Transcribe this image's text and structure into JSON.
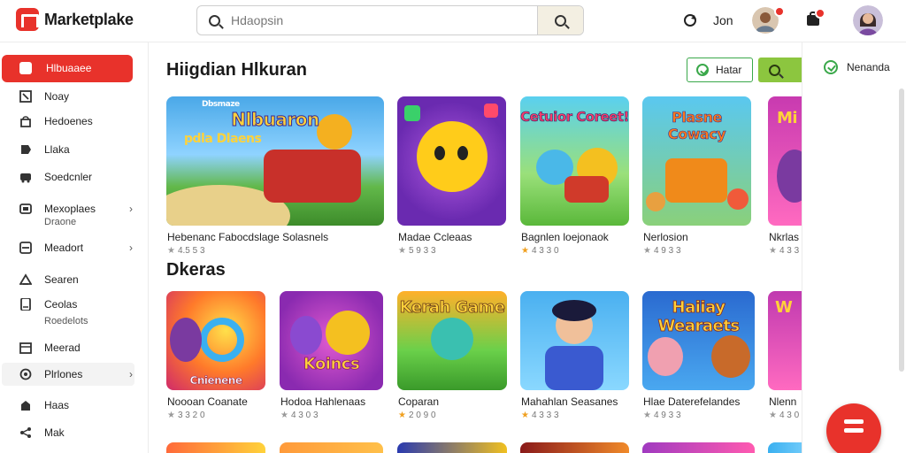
{
  "header": {
    "brand": "Marketplake",
    "search_placeholder": "Hdaopsin",
    "user_name": "Jon"
  },
  "sidebar": {
    "items": [
      {
        "label": "Hlbuaaee",
        "icon": "store-icon",
        "active": true
      },
      {
        "label": "Noay",
        "icon": "bookmark-icon"
      },
      {
        "label": "Hedoenes",
        "icon": "bag-icon"
      },
      {
        "label": "Llaka",
        "icon": "tag-icon"
      },
      {
        "label": "Soedcnler",
        "icon": "bus-icon"
      },
      {
        "label": "Mexoplaes",
        "icon": "book-icon",
        "sub": "Draone",
        "chevron": true
      },
      {
        "label": "Meadort",
        "icon": "grid-icon",
        "chevron": true
      },
      {
        "label": "Searen",
        "icon": "clock-icon"
      },
      {
        "label": "Ceolas",
        "icon": "phone-icon",
        "sub": "Roedelots"
      },
      {
        "label": "Meerad",
        "icon": "calendar-icon"
      },
      {
        "label": "Plrlones",
        "icon": "compass-icon",
        "chevron": true
      },
      {
        "label": "Haas",
        "icon": "home-icon"
      },
      {
        "label": "Mak",
        "icon": "share-icon"
      }
    ]
  },
  "main": {
    "section1_title": "Hiigdian Hlkuran",
    "section2_title": "Dkeras",
    "tag_button_1": "Hatar",
    "row1": [
      {
        "art_text": "Nlbuaron",
        "art_sub": "pdla Dlaens",
        "art_tag": "Dbsmaze",
        "title": "Hebenanc Fabocdslage Solasnels",
        "rating": "4.5 5 3",
        "gold": false
      },
      {
        "art_text": "",
        "title": "Madae Ccleaas",
        "rating": "5 9 3 3",
        "gold": false
      },
      {
        "art_text": "Cetuior Coreet!",
        "title": "Bagnlen loejonaok",
        "rating": "4 3 3 0",
        "gold": true
      },
      {
        "art_text": "Plasne Cowacy",
        "title": "Nerlosion",
        "rating": "4 9 3 3",
        "gold": false
      },
      {
        "art_text": "Mi",
        "title": "Nkrlas",
        "rating": "4 3 3",
        "gold": false
      }
    ],
    "row2": [
      {
        "art_text": "Cnienene",
        "title": "Noooan Coanate",
        "rating": "3 3 2 0",
        "gold": false
      },
      {
        "art_text": "Koincs",
        "title": "Hodoa Hahlenaas",
        "rating": "4 3 0 3",
        "gold": false
      },
      {
        "art_text": "Kerah Game",
        "title": "Coparan",
        "rating": "2 0 9 0",
        "gold": true
      },
      {
        "art_text": "",
        "title": "Mahahlan Seasanes",
        "rating": "4 3 3 3",
        "gold": true
      },
      {
        "art_text": "Haiiay Wearaets",
        "title": "Hlae Daterefelandes",
        "rating": "4 9 3 3",
        "gold": false
      },
      {
        "art_text": "W",
        "title": "Nlenn",
        "rating": "4 3 0",
        "gold": false
      }
    ]
  },
  "right_panel": {
    "item_label": "Nenanda"
  },
  "colors": {
    "accent": "#e8322b",
    "green": "#3aa84a",
    "lime": "#8cc63f"
  }
}
